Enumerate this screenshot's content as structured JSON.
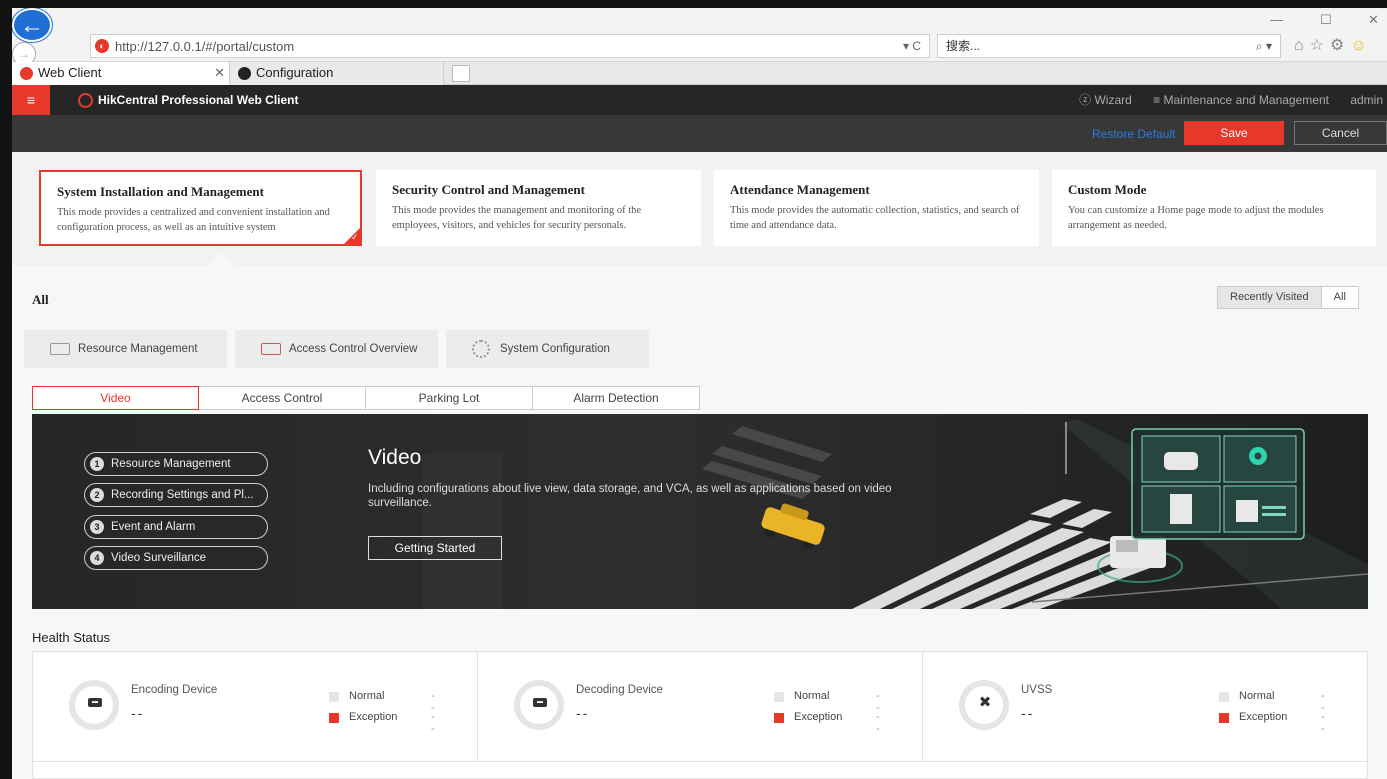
{
  "browser": {
    "url": "http://127.0.0.1/#/portal/custom",
    "url_tools": "▾ C",
    "search_placeholder": "搜索...",
    "tabs": [
      {
        "label": "Web Client"
      },
      {
        "label": "Configuration"
      }
    ]
  },
  "app": {
    "brand": "HikCentral Professional Web Client",
    "top_links": {
      "wizard": "Wizard",
      "maintenance": "Maintenance and Management",
      "user": "admin"
    },
    "toolbar": {
      "restore_default": "Restore Default",
      "save": "Save",
      "cancel": "Cancel"
    }
  },
  "modes": [
    {
      "title": "System Installation and Management",
      "desc": "This mode provides a centralized and convenient installation and configuration process, as well as an intuitive system",
      "selected": true
    },
    {
      "title": "Security Control and Management",
      "desc": "This mode provides the management and monitoring of the employees, visitors, and vehicles for security personals.",
      "selected": false
    },
    {
      "title": "Attendance Management",
      "desc": "This mode provides the automatic collection, statistics, and search of time and attendance data.",
      "selected": false
    },
    {
      "title": "Custom Mode",
      "desc": "You can customize a Home page mode to adjust the modules arrangement as needed.",
      "selected": false
    }
  ],
  "section": {
    "title": "All",
    "view_toggle": [
      "Recently Visited",
      "All"
    ]
  },
  "shortcuts": [
    {
      "label": "Resource Management",
      "icon": "server-icon"
    },
    {
      "label": "Access Control Overview",
      "icon": "access-control-icon"
    },
    {
      "label": "System Configuration",
      "icon": "gear-icon"
    }
  ],
  "sub_tabs": [
    "Video",
    "Access Control",
    "Parking Lot",
    "Alarm Detection"
  ],
  "banner": {
    "steps": [
      {
        "num": "1",
        "label": "Resource Management"
      },
      {
        "num": "2",
        "label": "Recording Settings and Pl..."
      },
      {
        "num": "3",
        "label": "Event and Alarm"
      },
      {
        "num": "4",
        "label": "Video Surveillance"
      }
    ],
    "title": "Video",
    "desc": "Including configurations about live view, data storage, and VCA, as well as applications based on video surveillance.",
    "cta": "Getting Started"
  },
  "health": {
    "title": "Health Status",
    "cells": [
      {
        "name": "Encoding Device",
        "count": "--",
        "normal_label": "Normal",
        "normal_val": "--",
        "exception_label": "Exception",
        "exception_val": "--"
      },
      {
        "name": "Decoding Device",
        "count": "--",
        "normal_label": "Normal",
        "normal_val": "--",
        "exception_label": "Exception",
        "exception_val": "--"
      },
      {
        "name": "UVSS",
        "count": "--",
        "normal_label": "Normal",
        "normal_val": "--",
        "exception_label": "Exception",
        "exception_val": "--"
      }
    ]
  },
  "colors": {
    "accent": "#e6392b",
    "link": "#2a7be4",
    "banner_bg": "#262626"
  }
}
